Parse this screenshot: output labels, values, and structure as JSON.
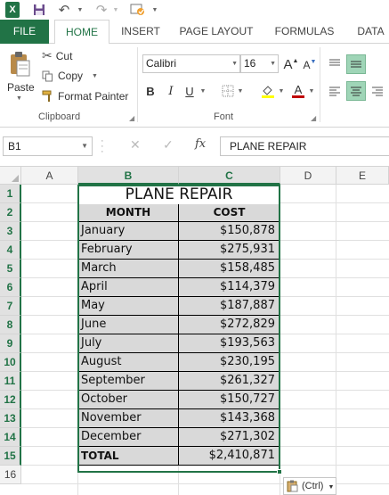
{
  "qat": {
    "app_icon": "X",
    "icons": [
      "excel-logo",
      "save-icon",
      "undo-icon",
      "redo-icon",
      "touch-mode-icon"
    ]
  },
  "tabs": [
    "FILE",
    "HOME",
    "INSERT",
    "PAGE LAYOUT",
    "FORMULAS",
    "DATA"
  ],
  "active_tab": "HOME",
  "ribbon": {
    "clipboard": {
      "paste": "Paste",
      "cut": "Cut",
      "copy": "Copy",
      "format_painter": "Format Painter",
      "label": "Clipboard"
    },
    "font": {
      "name": "Calibri",
      "size": "16",
      "label": "Font",
      "bold": "B",
      "italic": "I",
      "underline": "U",
      "grow": "A",
      "shrink": "A",
      "font_color_letter": "A"
    }
  },
  "formula_bar": {
    "name_box": "B1",
    "fx": "fx",
    "content": "PLANE REPAIR"
  },
  "grid": {
    "columns": [
      "A",
      "B",
      "C",
      "D",
      "E"
    ],
    "selected_columns": [
      "B",
      "C"
    ],
    "rows": [
      "1",
      "2",
      "3",
      "4",
      "5",
      "6",
      "7",
      "8",
      "9",
      "10",
      "11",
      "12",
      "13",
      "14",
      "15",
      "16"
    ],
    "title": "PLANE REPAIR",
    "headers": {
      "month": "MONTH",
      "cost": "COST"
    },
    "data": [
      {
        "month": "January",
        "cost": "$150,878"
      },
      {
        "month": "February",
        "cost": "$275,931"
      },
      {
        "month": "March",
        "cost": "$158,485"
      },
      {
        "month": "April",
        "cost": "$114,379"
      },
      {
        "month": "May",
        "cost": "$187,887"
      },
      {
        "month": "June",
        "cost": "$272,829"
      },
      {
        "month": "July",
        "cost": "$193,563"
      },
      {
        "month": "August",
        "cost": "$230,195"
      },
      {
        "month": "September",
        "cost": "$261,327"
      },
      {
        "month": "October",
        "cost": "$150,727"
      },
      {
        "month": "November",
        "cost": "$143,368"
      },
      {
        "month": "December",
        "cost": "$271,302"
      }
    ],
    "total": {
      "label": "TOTAL",
      "cost": "$2,410,871"
    }
  },
  "paste_options": "(Ctrl)",
  "colors": {
    "accent": "#217346",
    "cell_fill": "#d9d9d9",
    "font_highlight": "#ffff00",
    "font_color": "#c00000"
  }
}
